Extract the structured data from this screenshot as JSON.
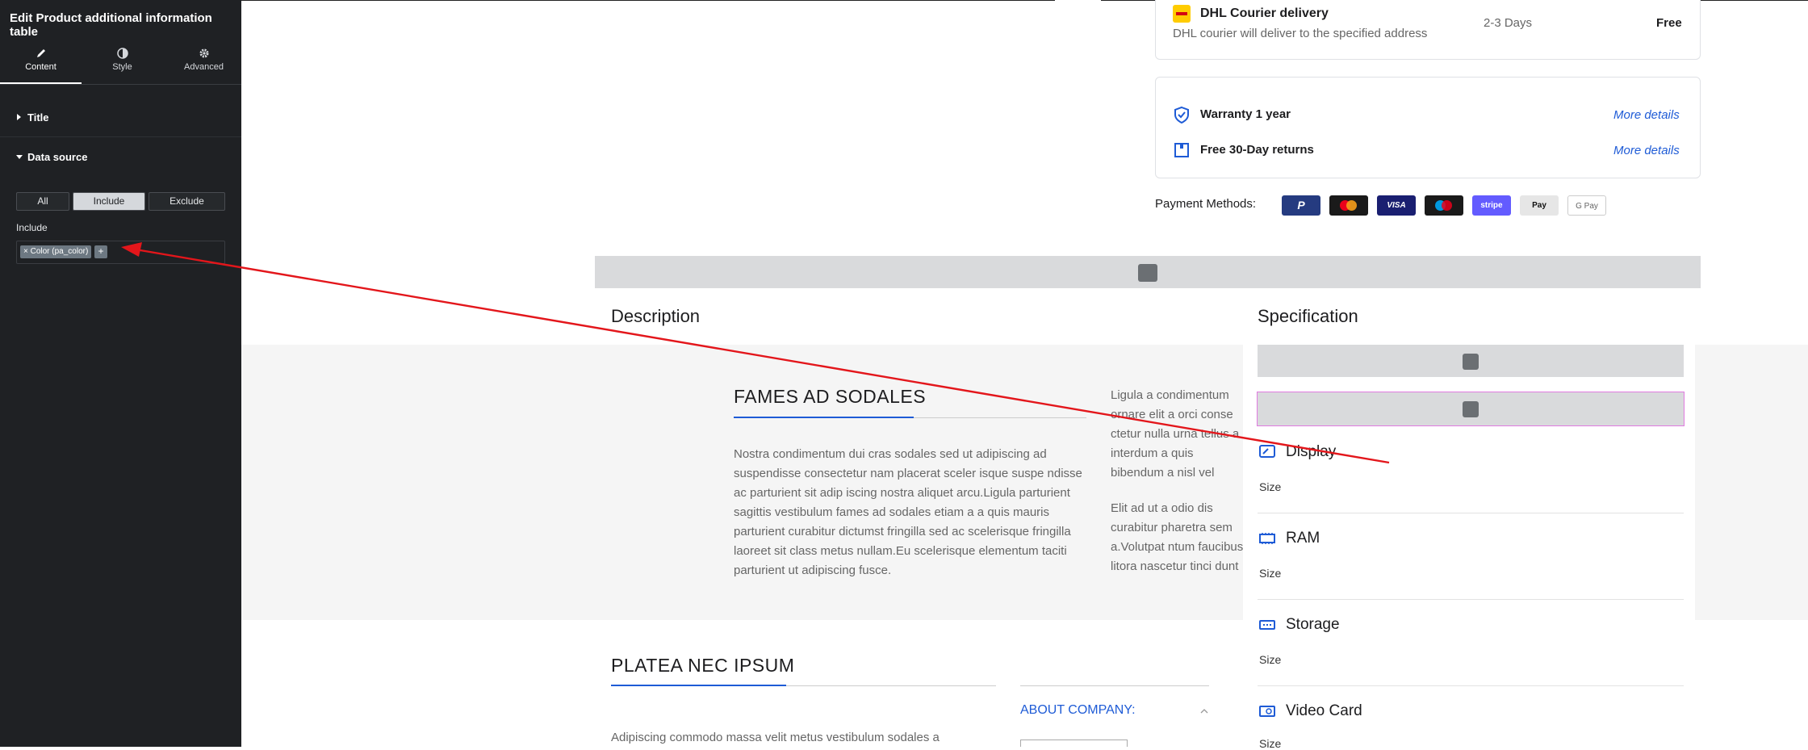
{
  "editor": {
    "title": "Edit Product additional information table",
    "tabs": [
      {
        "label": "Content",
        "icon": "pencil-icon",
        "active": true
      },
      {
        "label": "Style",
        "icon": "contrast-icon",
        "active": false
      },
      {
        "label": "Advanced",
        "icon": "gear-icon",
        "active": false
      }
    ],
    "sections": {
      "title": "Title",
      "data_source": "Data source"
    },
    "source_options": [
      "All",
      "Include",
      "Exclude"
    ],
    "selected_option": "Include",
    "include_label": "Include",
    "chip_label": "× Color (pa_color)",
    "chip_add": "+",
    "collapse_icon": "‹"
  },
  "shipping": {
    "name": "DHL Courier delivery",
    "description": "DHL courier will deliver to the specified address",
    "time": "2-3 Days",
    "price": "Free"
  },
  "guarantees": [
    {
      "label": "Warranty 1 year",
      "link": "More details",
      "icon": "shield-check-icon"
    },
    {
      "label": "Free 30-Day returns",
      "link": "More details",
      "icon": "return-box-icon"
    }
  ],
  "payment": {
    "label": "Payment Methods:",
    "methods": [
      {
        "name": "PayPal",
        "text": "P",
        "color": "#253b80"
      },
      {
        "name": "Mastercard",
        "text": "",
        "color": "#1a1a1a"
      },
      {
        "name": "Visa",
        "text": "VISA",
        "color": "#1a1f71"
      },
      {
        "name": "Maestro",
        "text": "",
        "color": "#1a1a1a"
      },
      {
        "name": "Stripe",
        "text": "stripe",
        "color": "#635bff"
      },
      {
        "name": "Apple Pay",
        "text": " Pay",
        "color": "#e6e6e6"
      },
      {
        "name": "Google Pay",
        "text": "G Pay",
        "color": "#ffffff"
      }
    ]
  },
  "tabs_headings": {
    "description": "Description",
    "specification": "Specification"
  },
  "description": {
    "heading1": "FAMES AD SODALES",
    "para1": "Nostra condimentum dui cras sodales sed ut adipiscing ad suspendisse consectetur nam placerat sceler isque suspe ndisse ac parturient sit adip iscing nostra aliquet arcu.Ligula parturient sagittis vestibulum fames ad sodales etiam a a quis mauris parturient curabitur dictumst fringilla sed ac scelerisque fringilla laoreet sit class metus nullam.Eu scelerisque elementum taciti parturient ut adipiscing fusce.",
    "para2": "Ligula a condimentum ornare elit a orci conse ctetur nulla urna tellus a interdum a quis bibendum a nisl vel suspendisse cursus vitae.",
    "para3": "Elit ad ut a odio dis curabitur pharetra sem a.Volutpat ntum faucibus litora nascetur tinci dunt purus. Leo dignissim.",
    "heading2": "PLATEA NEC IPSUM",
    "para4": "Adipiscing commodo massa velit metus vestibulum sodales a",
    "accordion": "ABOUT COMPANY:"
  },
  "specs": [
    {
      "title": "Display",
      "sub": "Size",
      "icon": "display-icon"
    },
    {
      "title": "RAM",
      "sub": "Size",
      "icon": "ram-icon"
    },
    {
      "title": "Storage",
      "sub": "Size",
      "icon": "storage-icon"
    },
    {
      "title": "Video Card",
      "sub": "Size",
      "icon": "video-card-icon"
    }
  ],
  "colors": {
    "accent": "#1e5bd6",
    "annotation": "#e3161b",
    "panel": "#1f2124"
  }
}
